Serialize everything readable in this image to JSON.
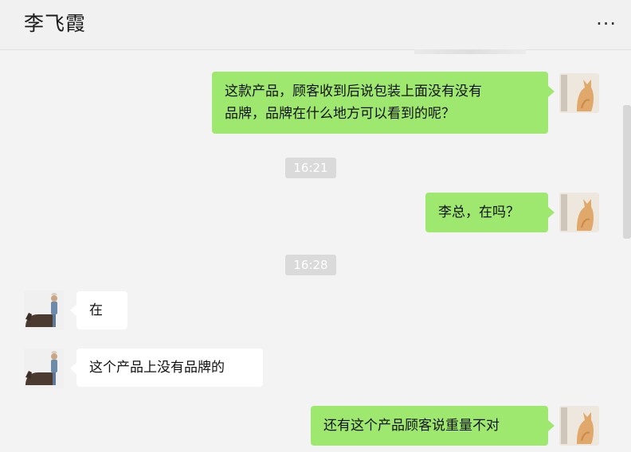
{
  "header": {
    "title": "李飞霞",
    "more_label": "···"
  },
  "messages": [
    {
      "type": "sent",
      "lines": [
        "这款产品，顾客收到后说包装上面没有没有",
        "品牌，品牌在什么地方可以看到的呢？"
      ]
    },
    {
      "type": "timestamp",
      "text": "16:21"
    },
    {
      "type": "sent",
      "lines": [
        "李总，在吗？"
      ]
    },
    {
      "type": "timestamp",
      "text": "16:28"
    },
    {
      "type": "received",
      "lines": [
        "在"
      ]
    },
    {
      "type": "received",
      "lines": [
        "这个产品上没有品牌的"
      ]
    },
    {
      "type": "sent",
      "lines": [
        "还有这个产品顾客说重量不对"
      ]
    }
  ],
  "colors": {
    "sent_bubble": "#9ee870",
    "received_bubble": "#ffffff",
    "background": "#f3f3f3",
    "timestamp_bg": "#dadada"
  },
  "icons": {
    "more": "more-dots-icon",
    "avatar_me": "cat-avatar-icon",
    "avatar_other": "horse-rider-avatar-icon"
  }
}
